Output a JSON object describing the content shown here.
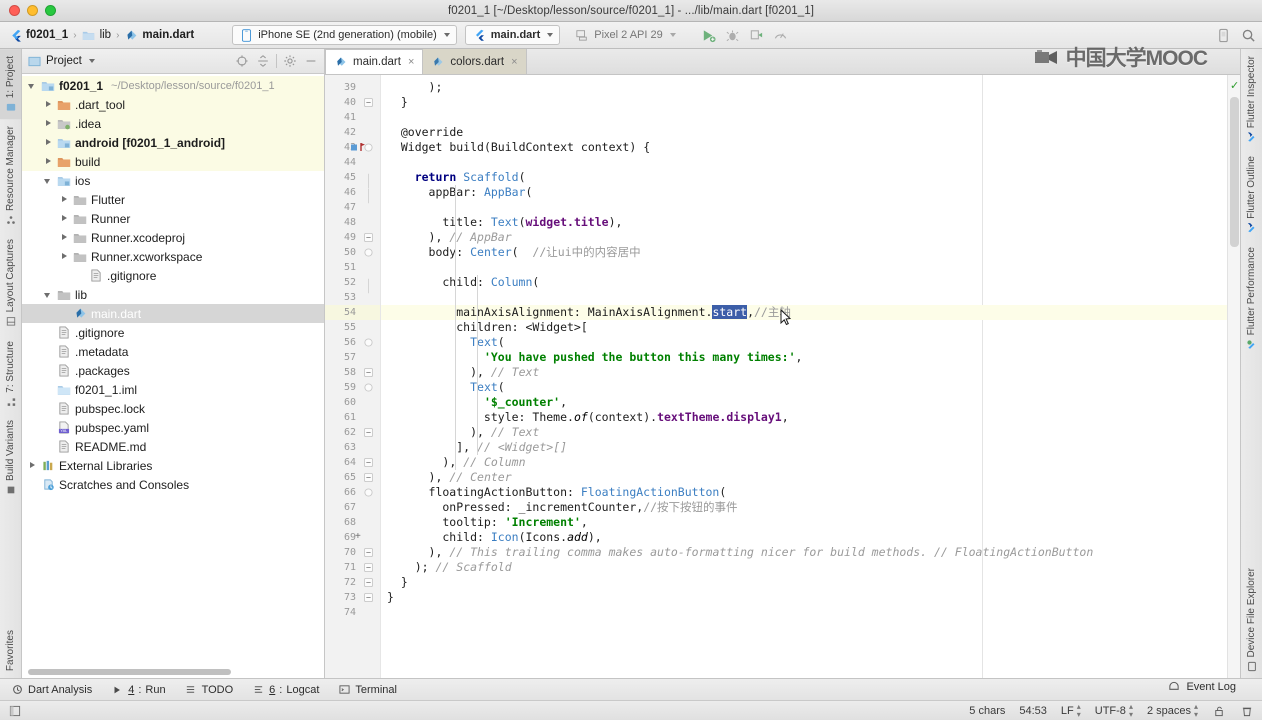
{
  "window": {
    "title": "f0201_1 [~/Desktop/lesson/source/f0201_1] - .../lib/main.dart [f0201_1]",
    "traffic_colors": {
      "close": "#ff5f57",
      "minimize": "#ffbd2e",
      "zoom": "#28c840"
    }
  },
  "watermark": {
    "text": "中国大学MOOC"
  },
  "navbar": {
    "breadcrumbs": [
      {
        "label": "f0201_1",
        "icon": "flutter-icon"
      },
      {
        "label": "lib",
        "icon": "folder-icon"
      },
      {
        "label": "main.dart",
        "icon": "dart-file-icon"
      }
    ],
    "separator": "›",
    "device_selector": {
      "label": "iPhone SE (2nd generation) (mobile)",
      "icon": "phone-icon"
    },
    "run_config": {
      "label": "main.dart",
      "icon": "flutter-icon"
    },
    "emulator": {
      "label": "Pixel 2 API 29",
      "icon": "device-icon"
    },
    "actions": [
      {
        "name": "run-button",
        "glyph": "▶"
      },
      {
        "name": "debug-button",
        "glyph": "🐞"
      },
      {
        "name": "profile-button",
        "glyph": "▣"
      },
      {
        "name": "coverage-button",
        "glyph": "◠"
      },
      {
        "name": "stop-button",
        "glyph": "■"
      }
    ],
    "right_actions": [
      {
        "name": "device-manager-icon",
        "glyph": "▤"
      },
      {
        "name": "search-everywhere-icon",
        "glyph": "🔍"
      }
    ]
  },
  "left_tool_strip": [
    {
      "label": "1: Project",
      "active": true,
      "icon": "project-icon"
    },
    {
      "label": "Resource Manager",
      "active": false,
      "icon": "resource-icon"
    },
    {
      "label": "Layout Captures",
      "active": false,
      "icon": "layout-icon"
    },
    {
      "label": "7: Structure",
      "active": false,
      "icon": "structure-icon"
    },
    {
      "label": "Build Variants",
      "active": false,
      "icon": "variants-icon"
    },
    {
      "label": "Favorites",
      "active": false,
      "icon": "favorites-icon"
    }
  ],
  "right_tool_strip": [
    {
      "label": "Flutter Inspector",
      "icon": "flutter-icon"
    },
    {
      "label": "Flutter Outline",
      "icon": "flutter-icon"
    },
    {
      "label": "Flutter Performance",
      "icon": "flutter-perf-icon"
    },
    {
      "label": "Device File Explorer",
      "icon": "device-file-icon"
    }
  ],
  "project_panel": {
    "title": "Project",
    "title_icon": "project-icon",
    "toolbar_icons": [
      {
        "name": "locate-target-icon",
        "glyph": "◎"
      },
      {
        "name": "collapse-all-icon",
        "glyph": "⇥"
      },
      {
        "name": "settings-gear-icon",
        "glyph": "⚙"
      },
      {
        "name": "hide-panel-icon",
        "glyph": "—"
      }
    ],
    "tree": [
      {
        "label": "f0201_1",
        "path": "~/Desktop/lesson/source/f0201_1",
        "indent": 0,
        "arrow": "open",
        "icon": "module-folder-icon",
        "bold": true,
        "highlight": true
      },
      {
        "label": ".dart_tool",
        "indent": 1,
        "arrow": "closed",
        "icon": "folder-orange-icon",
        "highlight": true
      },
      {
        "label": ".idea",
        "indent": 1,
        "arrow": "closed",
        "icon": "folder-excluded-icon",
        "highlight": true
      },
      {
        "label": "android [f0201_1_android]",
        "indent": 1,
        "arrow": "closed",
        "icon": "module-folder-icon",
        "bold": true,
        "highlight": true
      },
      {
        "label": "build",
        "indent": 1,
        "arrow": "closed",
        "icon": "folder-orange-icon",
        "highlight": true
      },
      {
        "label": "ios",
        "indent": 1,
        "arrow": "open",
        "icon": "module-folder-icon"
      },
      {
        "label": "Flutter",
        "indent": 2,
        "arrow": "closed",
        "icon": "folder-icon"
      },
      {
        "label": "Runner",
        "indent": 2,
        "arrow": "closed",
        "icon": "folder-icon"
      },
      {
        "label": "Runner.xcodeproj",
        "indent": 2,
        "arrow": "closed",
        "icon": "folder-icon"
      },
      {
        "label": "Runner.xcworkspace",
        "indent": 2,
        "arrow": "closed",
        "icon": "folder-icon"
      },
      {
        "label": ".gitignore",
        "indent": 3,
        "arrow": "none",
        "icon": "text-file-icon"
      },
      {
        "label": "lib",
        "indent": 1,
        "arrow": "open",
        "icon": "folder-icon"
      },
      {
        "label": "main.dart",
        "indent": 2,
        "arrow": "none",
        "icon": "dart-file-icon",
        "selected": true
      },
      {
        "label": ".gitignore",
        "indent": 1,
        "arrow": "none",
        "icon": "text-file-icon"
      },
      {
        "label": ".metadata",
        "indent": 1,
        "arrow": "none",
        "icon": "text-file-icon"
      },
      {
        "label": ".packages",
        "indent": 1,
        "arrow": "none",
        "icon": "text-file-icon"
      },
      {
        "label": "f0201_1.iml",
        "indent": 1,
        "arrow": "none",
        "icon": "iml-file-icon"
      },
      {
        "label": "pubspec.lock",
        "indent": 1,
        "arrow": "none",
        "icon": "text-file-icon"
      },
      {
        "label": "pubspec.yaml",
        "indent": 1,
        "arrow": "none",
        "icon": "yaml-file-icon"
      },
      {
        "label": "README.md",
        "indent": 1,
        "arrow": "none",
        "icon": "text-file-icon"
      },
      {
        "label": "External Libraries",
        "indent": 0,
        "arrow": "closed",
        "icon": "libraries-icon"
      },
      {
        "label": "Scratches and Consoles",
        "indent": 0,
        "arrow": "none",
        "icon": "scratches-icon"
      }
    ]
  },
  "editor": {
    "tabs": [
      {
        "label": "main.dart",
        "icon": "dart-file-icon",
        "active": true,
        "close": "×"
      },
      {
        "label": "colors.dart",
        "icon": "dart-file-icon",
        "active": false,
        "close": "×"
      }
    ],
    "first_line_number": 39,
    "highlight_line": 54,
    "inspection_status_glyph": "✓",
    "lines": [
      {
        "n": 39,
        "text": "      );",
        "indent": 0
      },
      {
        "n": 40,
        "text": "  }",
        "indent": 0
      },
      {
        "n": 41,
        "text": "",
        "indent": 0
      },
      {
        "n": 42,
        "text": "  @override",
        "indent": 0
      },
      {
        "n": 43,
        "text": "  Widget build(BuildContext context) {",
        "indent": 0
      },
      {
        "n": 44,
        "text": "",
        "indent": 0
      },
      {
        "n": 45,
        "text": "    return Scaffold(",
        "indent": 0
      },
      {
        "n": 46,
        "text": "      appBar: AppBar(",
        "indent": 0
      },
      {
        "n": 47,
        "text": "",
        "indent": 0
      },
      {
        "n": 48,
        "text": "        title: Text(widget.title),",
        "indent": 0
      },
      {
        "n": 49,
        "text": "      ), // AppBar",
        "indent": 0
      },
      {
        "n": 50,
        "text": "      body: Center(  //让ui中的内容居中",
        "indent": 0
      },
      {
        "n": 51,
        "text": "",
        "indent": 0
      },
      {
        "n": 52,
        "text": "        child: Column(",
        "indent": 0
      },
      {
        "n": 53,
        "text": "",
        "indent": 0
      },
      {
        "n": 54,
        "text": "          mainAxisAlignment: MainAxisAlignment.start,//主轴",
        "indent": 0
      },
      {
        "n": 55,
        "text": "          children: <Widget>[",
        "indent": 0
      },
      {
        "n": 56,
        "text": "            Text(",
        "indent": 0
      },
      {
        "n": 57,
        "text": "              'You have pushed the button this many times:',",
        "indent": 0
      },
      {
        "n": 58,
        "text": "            ), // Text",
        "indent": 0
      },
      {
        "n": 59,
        "text": "            Text(",
        "indent": 0
      },
      {
        "n": 60,
        "text": "              '$_counter',",
        "indent": 0
      },
      {
        "n": 61,
        "text": "              style: Theme.of(context).textTheme.display1,",
        "indent": 0
      },
      {
        "n": 62,
        "text": "            ), // Text",
        "indent": 0
      },
      {
        "n": 63,
        "text": "          ], // <Widget>[]",
        "indent": 0
      },
      {
        "n": 64,
        "text": "        ), // Column",
        "indent": 0
      },
      {
        "n": 65,
        "text": "      ), // Center",
        "indent": 0
      },
      {
        "n": 66,
        "text": "      floatingActionButton: FloatingActionButton(",
        "indent": 0
      },
      {
        "n": 67,
        "text": "        onPressed: _incrementCounter,//按下按钮的事件",
        "indent": 0
      },
      {
        "n": 68,
        "text": "        tooltip: 'Increment',",
        "indent": 0
      },
      {
        "n": 69,
        "text": "        child: Icon(Icons.add),",
        "indent": 0
      },
      {
        "n": 70,
        "text": "      ), // This trailing comma makes auto-formatting nicer for build methods. // FloatingActionButton",
        "indent": 0
      },
      {
        "n": 71,
        "text": "    ); // Scaffold",
        "indent": 0
      },
      {
        "n": 72,
        "text": "  }",
        "indent": 0
      },
      {
        "n": 73,
        "text": "}",
        "indent": 0
      },
      {
        "n": 74,
        "text": "",
        "indent": 0
      }
    ],
    "selection_token": "start",
    "expand_marker": "+",
    "expand_marker_line": 69
  },
  "bottom_tool_windows": [
    {
      "label": "Dart Analysis",
      "mnemonic": "",
      "icon": "dart-analysis-icon"
    },
    {
      "label": "Run",
      "mnemonic": "4",
      "icon": "run-icon"
    },
    {
      "label": "TODO",
      "mnemonic": "",
      "icon": "todo-icon"
    },
    {
      "label": "Logcat",
      "mnemonic": "6",
      "icon": "logcat-icon"
    },
    {
      "label": "Terminal",
      "mnemonic": "",
      "icon": "terminal-icon"
    }
  ],
  "event_log": {
    "label": "Event Log",
    "icon": "event-log-icon"
  },
  "status_bar": {
    "left_icon": "toggle-toolwindows-icon",
    "chars": "5 chars",
    "caret": "54:53",
    "line_separator": "LF",
    "encoding": "UTF-8",
    "indent": "2 spaces",
    "lock_icon": "unlocked-icon",
    "trash_icon": "memory-indicator-icon"
  },
  "colors": {
    "keyword": "#000080",
    "class": "#3b7ec2",
    "string": "#008000",
    "comment": "#9a9a9a",
    "field": "#660e7a",
    "selection": "#3c5ea8",
    "line_highlight": "#fdfde8",
    "tree_highlight": "#fbfbe4"
  }
}
